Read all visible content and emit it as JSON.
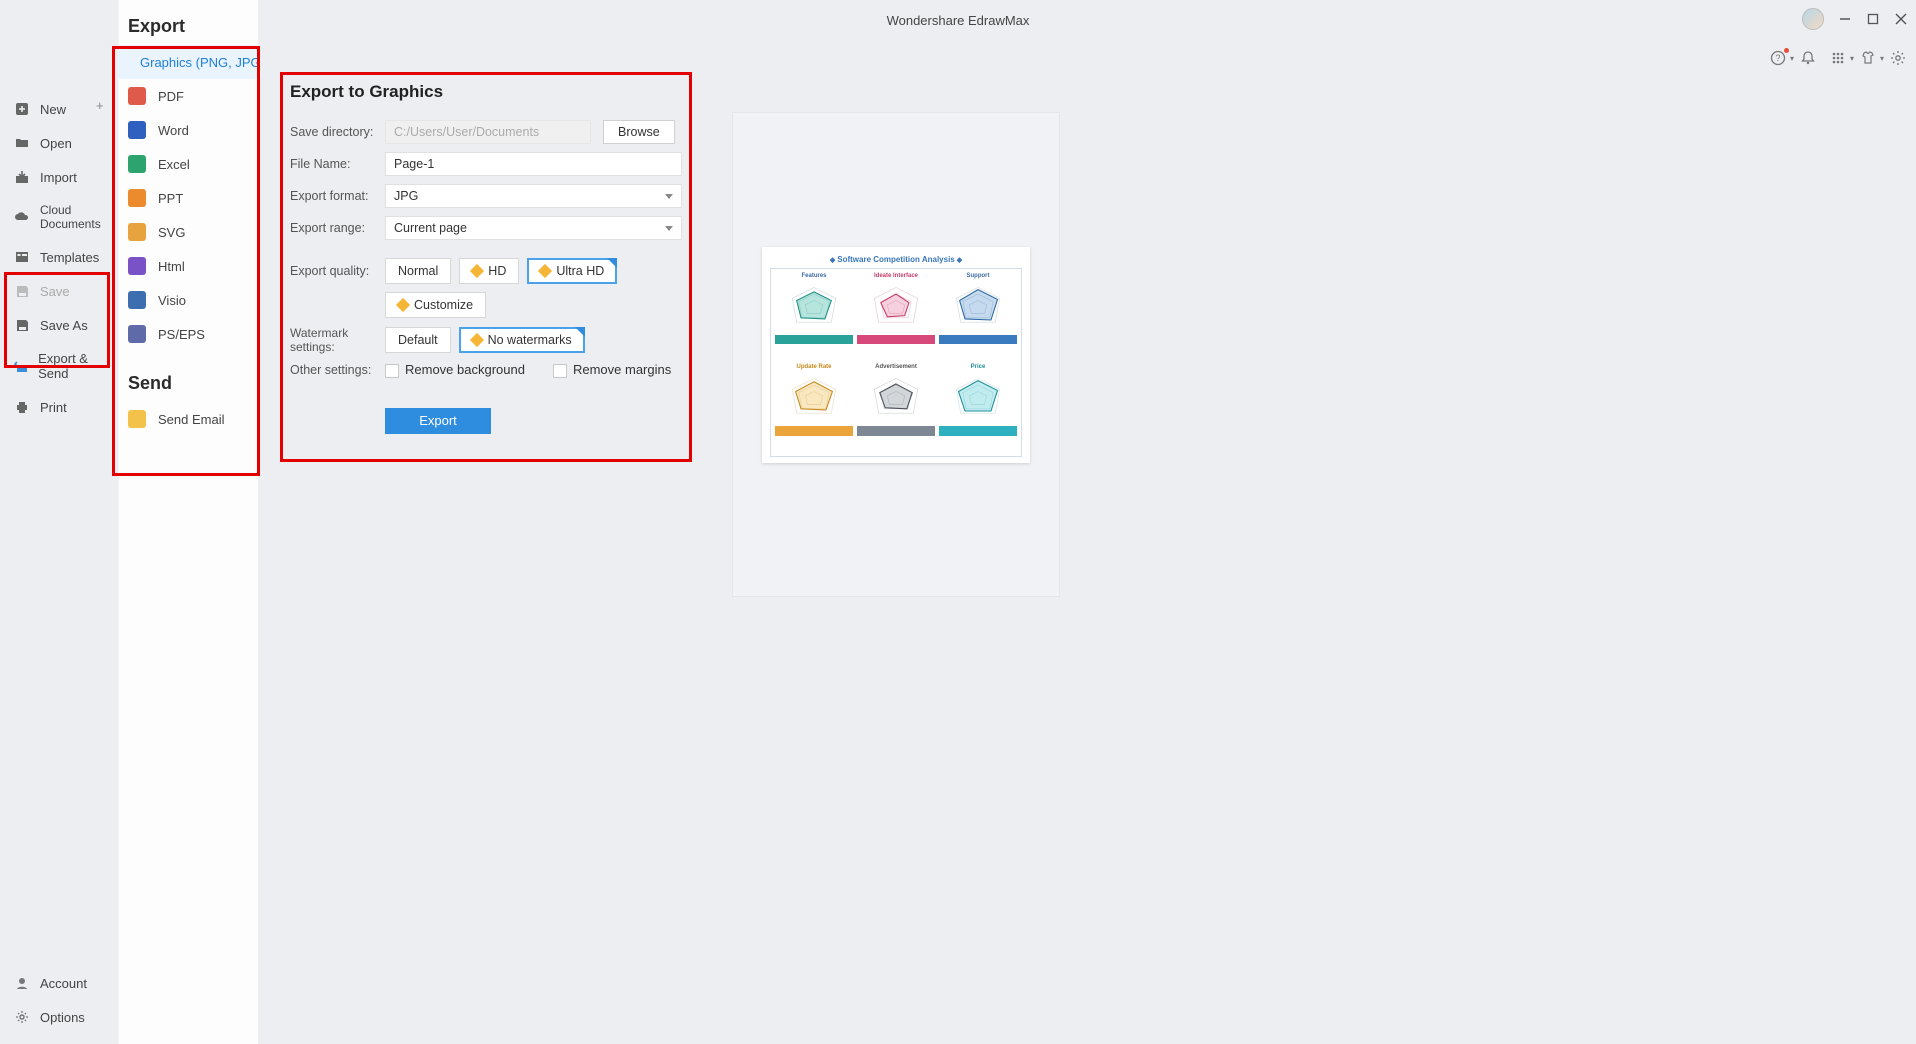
{
  "app": {
    "title": "Wondershare EdrawMax"
  },
  "rail": {
    "items": [
      {
        "key": "new",
        "label": "New"
      },
      {
        "key": "open",
        "label": "Open"
      },
      {
        "key": "import",
        "label": "Import"
      },
      {
        "key": "cloud",
        "label": "Cloud Documents"
      },
      {
        "key": "templates",
        "label": "Templates"
      },
      {
        "key": "save",
        "label": "Save"
      },
      {
        "key": "saveas",
        "label": "Save As"
      },
      {
        "key": "exportsend",
        "label": "Export & Send"
      },
      {
        "key": "print",
        "label": "Print"
      }
    ],
    "bottom": [
      {
        "key": "account",
        "label": "Account"
      },
      {
        "key": "options",
        "label": "Options"
      }
    ]
  },
  "exportCol": {
    "header": "Export",
    "sendHeader": "Send",
    "formats": [
      {
        "key": "graphics",
        "label": "Graphics (PNG, JPG e…"
      },
      {
        "key": "pdf",
        "label": "PDF"
      },
      {
        "key": "word",
        "label": "Word"
      },
      {
        "key": "excel",
        "label": "Excel"
      },
      {
        "key": "ppt",
        "label": "PPT"
      },
      {
        "key": "svg",
        "label": "SVG"
      },
      {
        "key": "html",
        "label": "Html"
      },
      {
        "key": "visio",
        "label": "Visio"
      },
      {
        "key": "pseps",
        "label": "PS/EPS"
      }
    ],
    "sendItems": [
      {
        "key": "email",
        "label": "Send Email"
      }
    ]
  },
  "form": {
    "title": "Export to Graphics",
    "labels": {
      "saveDir": "Save directory:",
      "fileName": "File Name:",
      "format": "Export format:",
      "range": "Export range:",
      "quality": "Export quality:",
      "watermark": "Watermark settings:",
      "other": "Other settings:"
    },
    "values": {
      "saveDir": "C:/Users/User/Documents",
      "fileName": "Page-1",
      "format": "JPG",
      "range": "Current page"
    },
    "buttons": {
      "browse": "Browse",
      "normal": "Normal",
      "hd": "HD",
      "ultra": "Ultra HD",
      "customize": "Customize",
      "wm_default": "Default",
      "wm_none": "No watermarks",
      "export": "Export"
    },
    "checks": {
      "removeBg": "Remove background",
      "removeMargins": "Remove margins"
    }
  },
  "preview": {
    "title": "Software Competition Analysis",
    "cells": [
      {
        "label": "Features",
        "noteClass": "n-teal"
      },
      {
        "label": "Ideate Interface",
        "noteClass": "n-pink"
      },
      {
        "label": "Support",
        "noteClass": "n-blue"
      },
      {
        "label": "Update Rate",
        "noteClass": "n-amber"
      },
      {
        "label": "Advertisement",
        "noteClass": "n-gray"
      },
      {
        "label": "Price",
        "noteClass": "n-cyan"
      }
    ]
  }
}
